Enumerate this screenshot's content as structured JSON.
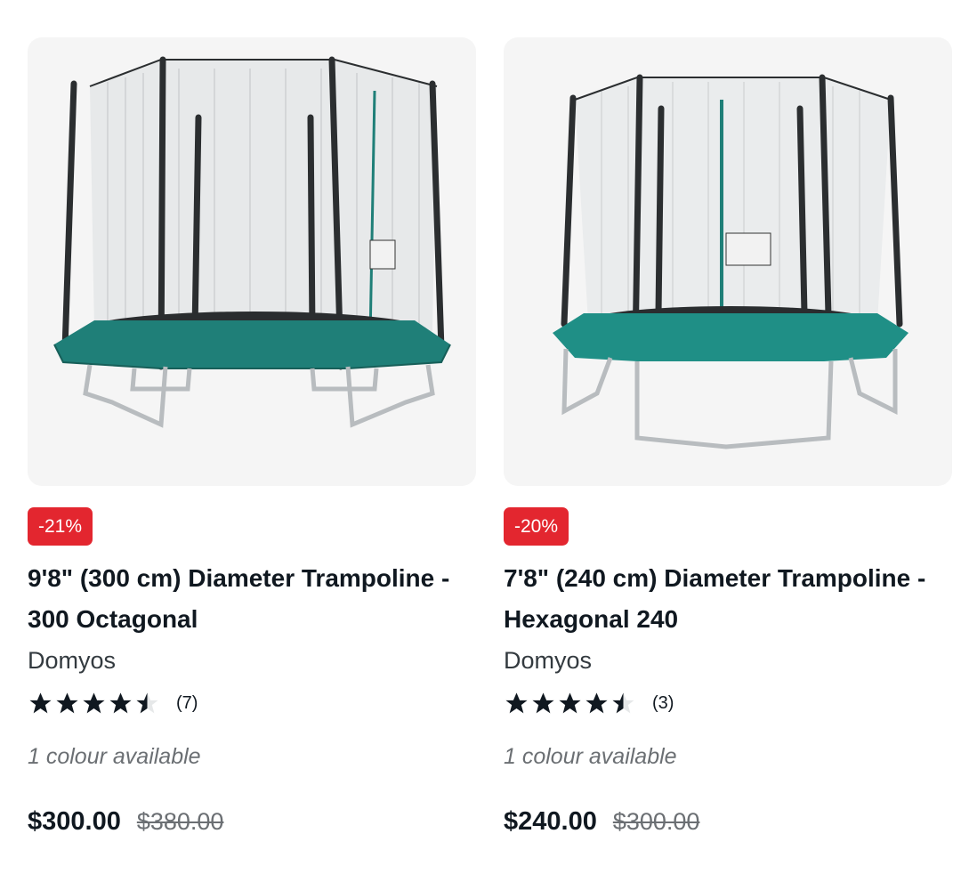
{
  "products": [
    {
      "image_alt": "9'8\" (300 cm) Diameter Trampoline - 300 Octagonal",
      "badge": "-21%",
      "title": "9'8\" (300 cm) Diameter Trampoline - 300 Octagonal",
      "brand": "Domyos",
      "rating": 4.5,
      "review_count": "(7)",
      "colours": "1 colour available",
      "price": "$300.00",
      "old_price": "$380.00"
    },
    {
      "image_alt": "7'8\" (240 cm) Diameter Trampoline - Hexagonal 240",
      "badge": "-20%",
      "title": "7'8\" (240 cm) Diameter Trampoline - Hexagonal 240",
      "brand": "Domyos",
      "rating": 4.5,
      "review_count": "(3)",
      "colours": "1 colour available",
      "price": "$240.00",
      "old_price": "$300.00"
    }
  ],
  "colors": {
    "badge_bg": "#e3262f",
    "pad_green": "#1f7f78",
    "star": "#101820"
  }
}
